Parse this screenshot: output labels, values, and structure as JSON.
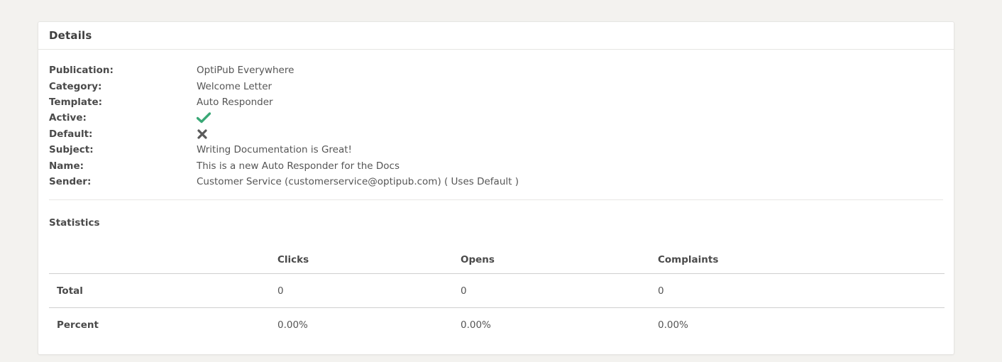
{
  "details_panel": {
    "title": "Details",
    "fields": [
      {
        "label": "Publication:",
        "value": "OptiPub Everywhere"
      },
      {
        "label": "Category:",
        "value": "Welcome Letter"
      },
      {
        "label": "Template:",
        "value": "Auto Responder"
      },
      {
        "label": "Active:",
        "icon": "check-icon",
        "icon_color": "#3aa876"
      },
      {
        "label": "Default:",
        "icon": "close-icon",
        "icon_color": "#5a5a5a"
      },
      {
        "label": "Subject:",
        "value": "Writing Documentation is Great!"
      },
      {
        "label": "Name:",
        "value": "This is a new Auto Responder for the Docs"
      },
      {
        "label": "Sender:",
        "value": "Customer Service (customerservice@optipub.com) ( Uses Default )"
      }
    ]
  },
  "statistics": {
    "title": "Statistics",
    "columns": [
      "Clicks",
      "Opens",
      "Complaints"
    ],
    "rows": [
      {
        "label": "Total",
        "values": [
          "0",
          "0",
          "0"
        ]
      },
      {
        "label": "Percent",
        "values": [
          "0.00%",
          "0.00%",
          "0.00%"
        ]
      }
    ]
  }
}
